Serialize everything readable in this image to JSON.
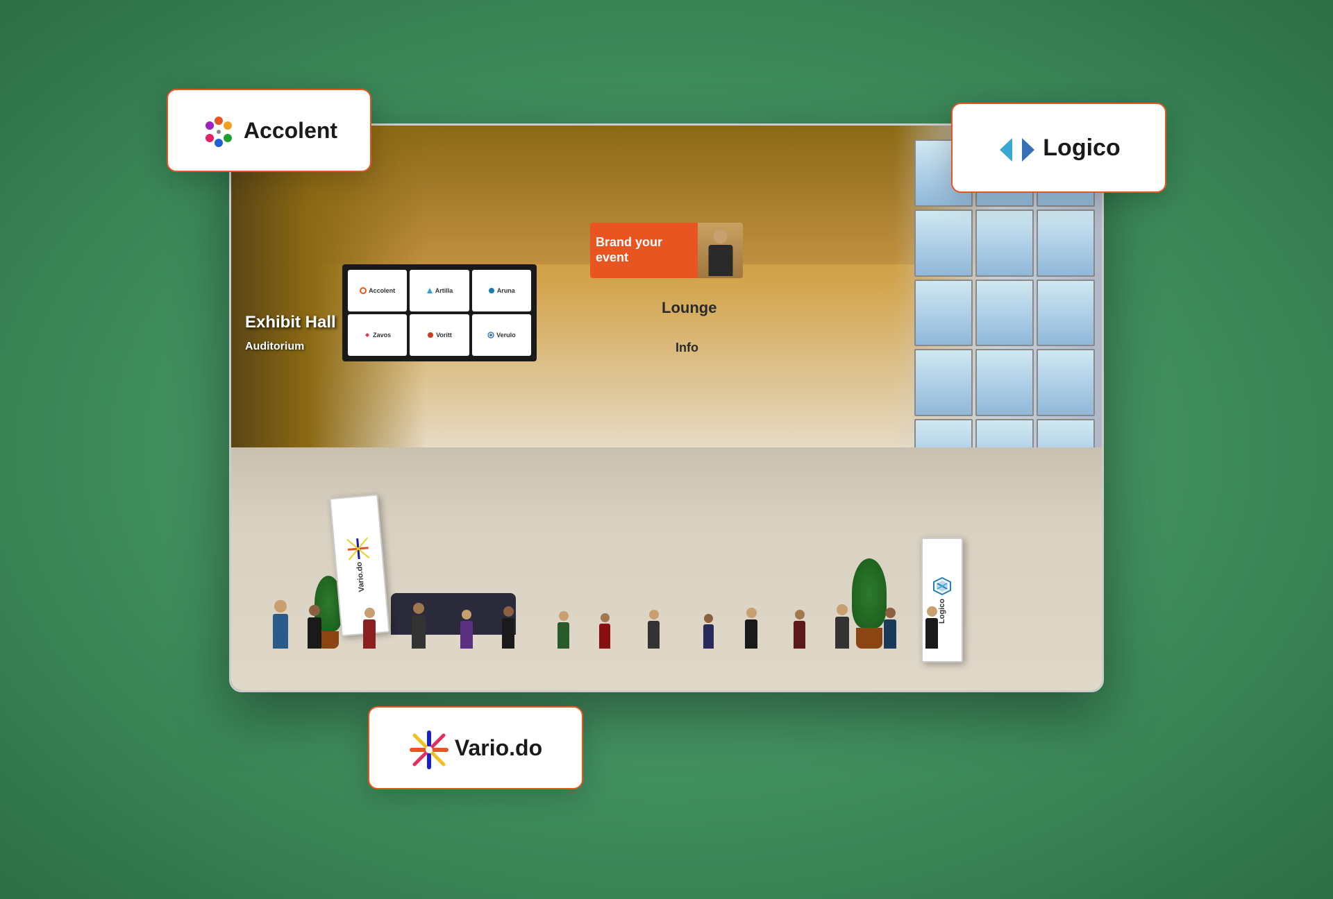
{
  "scene": {
    "background_color": "#4a9b6f"
  },
  "venue": {
    "signs": {
      "exhibit_hall": "Exhibit Hall",
      "auditorium": "Auditorium",
      "lounge": "Lounge",
      "info": "Info"
    },
    "banner": {
      "text": "Brand your event",
      "bg_color": "#e85520"
    },
    "sponsors": [
      {
        "name": "Accolent",
        "row": 0,
        "col": 0
      },
      {
        "name": "Artilla",
        "row": 0,
        "col": 1
      },
      {
        "name": "Aruna",
        "row": 0,
        "col": 2
      },
      {
        "name": "Zavos",
        "row": 1,
        "col": 0
      },
      {
        "name": "Voritt",
        "row": 1,
        "col": 1
      },
      {
        "name": "Verulo",
        "row": 1,
        "col": 2
      }
    ]
  },
  "logo_cards": {
    "accolent": {
      "name": "Accolent",
      "position": "top-left"
    },
    "logico": {
      "name": "Logico",
      "position": "top-right"
    },
    "variodo": {
      "name": "Vario.do",
      "position": "bottom-center"
    }
  },
  "sign_posts": {
    "left": {
      "brand": "Vario.do"
    },
    "right": {
      "brand": "Logico"
    }
  }
}
